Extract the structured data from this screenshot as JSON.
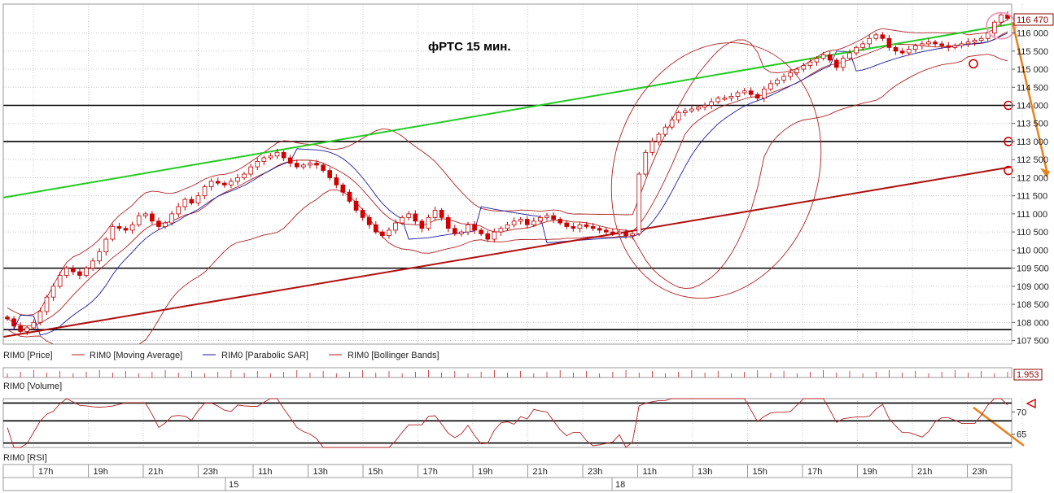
{
  "chart_data": [
    {
      "type": "candlestick",
      "title": "фРТС    15 мин.",
      "ylim": [
        107400,
        116800
      ],
      "y_ticks": [
        107500,
        108000,
        108500,
        109000,
        109500,
        110000,
        110500,
        111000,
        111500,
        112000,
        112500,
        113000,
        113500,
        114000,
        114500,
        115000,
        115500,
        116000
      ],
      "y_tick_labels": [
        "107 500",
        "108 000",
        "108 500",
        "109 000",
        "109 500",
        "110 000",
        "110 500",
        "111 000",
        "111 500",
        "112 000",
        "112 500",
        "113 000",
        "113 500",
        "114 000",
        "114 500",
        "115 000",
        "115 500",
        "116 000"
      ],
      "last_price_label": "116 470",
      "last_price": 116470,
      "up_color": "#ffffff",
      "down_color": "#d40000",
      "candle_outline": "#c00000",
      "close_series": [
        108100,
        107900,
        107750,
        107850,
        108000,
        108300,
        108700,
        109000,
        109300,
        109500,
        109400,
        109300,
        109500,
        109700,
        109950,
        110300,
        110650,
        110600,
        110550,
        110700,
        110950,
        111000,
        110800,
        110650,
        110750,
        111000,
        111200,
        111400,
        111300,
        111500,
        111750,
        111900,
        111850,
        111800,
        111900,
        112000,
        112100,
        112300,
        112450,
        112550,
        112600,
        112700,
        112550,
        112400,
        112300,
        112350,
        112400,
        112350,
        112200,
        112000,
        111800,
        111600,
        111350,
        111100,
        110900,
        110700,
        110500,
        110400,
        110550,
        110750,
        110900,
        111000,
        110800,
        110600,
        110900,
        111100,
        110900,
        110600,
        110450,
        110500,
        110700,
        110550,
        110450,
        110300,
        110500,
        110600,
        110700,
        110800,
        110850,
        110700,
        110800,
        110900,
        110950,
        110850,
        110750,
        110650,
        110600,
        110700,
        110650,
        110600,
        110550,
        110500,
        110450,
        110500,
        110400,
        110450,
        112100,
        112700,
        113000,
        113200,
        113400,
        113600,
        113800,
        113850,
        113900,
        113950,
        114000,
        114100,
        114200,
        114200,
        114250,
        114350,
        114400,
        114300,
        114200,
        114450,
        114600,
        114700,
        114800,
        114900,
        115000,
        115100,
        115200,
        115300,
        115400,
        115250,
        115050,
        115300,
        115450,
        115600,
        115700,
        115850,
        115950,
        115850,
        115600,
        115500,
        115450,
        115550,
        115650,
        115700,
        115750,
        115700,
        115650,
        115600,
        115650,
        115700,
        115750,
        115800,
        115850,
        116000,
        116300,
        116500,
        116400
      ],
      "horizontal_levels": [
        114000,
        113000,
        109500,
        107800
      ],
      "green_trend": {
        "from": [
          0,
          111450
        ],
        "to": [
          160,
          116250
        ]
      },
      "red_trend": {
        "from": [
          0,
          107600
        ],
        "to": [
          160,
          112300
        ]
      }
    },
    {
      "type": "bar",
      "title": "RIM0 [Volume]",
      "last_value_label": "1.953"
    },
    {
      "type": "line",
      "title": "RIM0 [RSI]",
      "y_ticks": [
        65,
        70
      ],
      "y_tick_labels": [
        "65",
        "70"
      ],
      "levels": [
        72,
        68,
        63
      ],
      "ylim": [
        62,
        73
      ]
    }
  ],
  "legend": {
    "price": "RIM0 [Price]",
    "ma": "RIM0 [Moving Average]",
    "sar": "RIM0 [Parabolic SAR]",
    "bb": "RIM0 [Bollinger Bands]"
  },
  "x_axis": {
    "hour_labels": [
      "17h",
      "19h",
      "21h",
      "23h",
      "11h",
      "13h",
      "15h",
      "17h",
      "19h",
      "21h",
      "23h",
      "11h",
      "13h",
      "15h",
      "17h",
      "19h",
      "21h",
      "23h"
    ],
    "day_labels": [
      "15",
      "18"
    ]
  },
  "colors": {
    "ma": "#b22222",
    "sar": "#1a1aa0",
    "bb": "#b22222",
    "green_trend": "#22cc22",
    "red_trend": "#b01010",
    "annotation": "#e8801a"
  }
}
